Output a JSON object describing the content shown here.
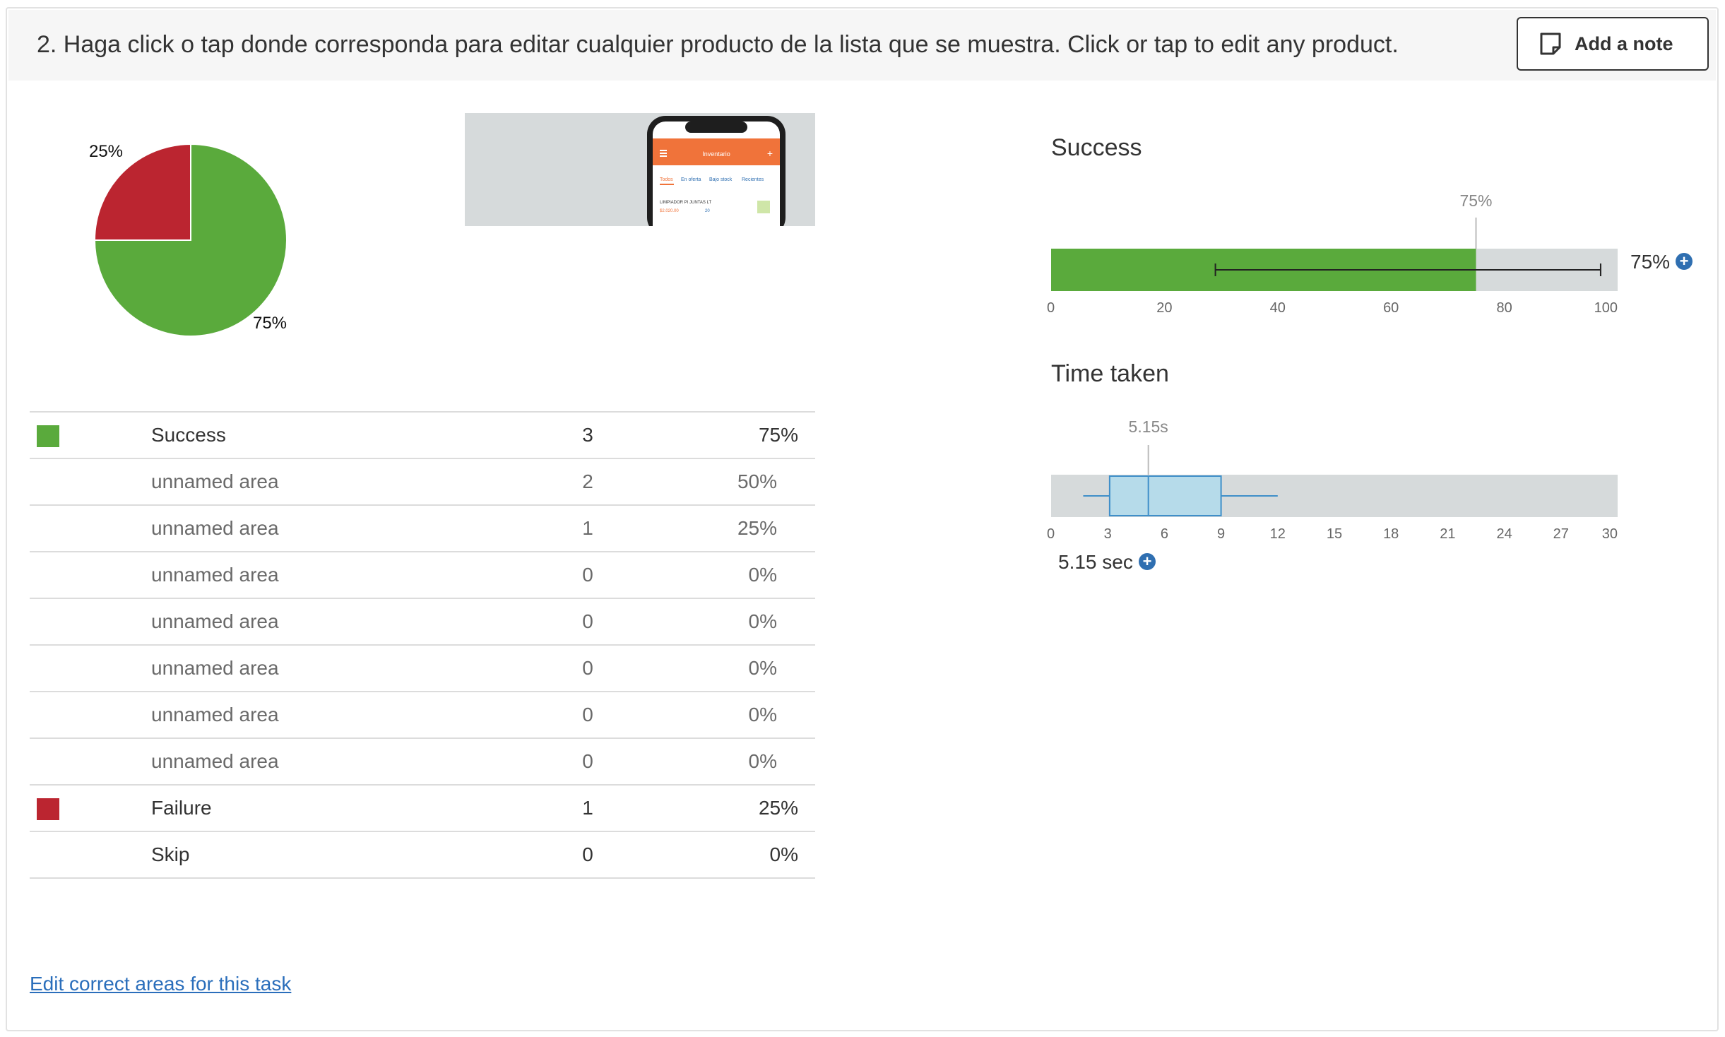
{
  "task": {
    "title": "2. Haga click o tap donde corresponda para editar cualquier producto de la lista que se muestra. Click or tap to edit any product.",
    "add_note_label": "Add a note"
  },
  "colors": {
    "success": "#5aaa3c",
    "failure": "#bb2530",
    "track": "#d6dadb",
    "box": "#b6dbea",
    "box_border": "#3f8fc9",
    "link": "#2a6ebb",
    "phone_header": "#f0733a"
  },
  "pie": {
    "labels": {
      "success": "75%",
      "failure": "25%"
    }
  },
  "thumbnail": {
    "header_text": "Inventario",
    "tabs": [
      "Todos",
      "En oferta",
      "Bajo stock",
      "Recientes"
    ],
    "item_text": "LIMPIADOR PI JUNTAS LT",
    "item_sub": "$2.020.00",
    "item_qty": "20"
  },
  "table": {
    "rows": [
      {
        "name": "Success",
        "count": "3",
        "pct": "75%",
        "type": "success"
      },
      {
        "name": "unnamed area",
        "count": "2",
        "pct": "50%",
        "type": "sub"
      },
      {
        "name": "unnamed area",
        "count": "1",
        "pct": "25%",
        "type": "sub"
      },
      {
        "name": "unnamed area",
        "count": "0",
        "pct": "0%",
        "type": "sub"
      },
      {
        "name": "unnamed area",
        "count": "0",
        "pct": "0%",
        "type": "sub"
      },
      {
        "name": "unnamed area",
        "count": "0",
        "pct": "0%",
        "type": "sub"
      },
      {
        "name": "unnamed area",
        "count": "0",
        "pct": "0%",
        "type": "sub"
      },
      {
        "name": "unnamed area",
        "count": "0",
        "pct": "0%",
        "type": "sub"
      },
      {
        "name": "Failure",
        "count": "1",
        "pct": "25%",
        "type": "failure"
      },
      {
        "name": "Skip",
        "count": "0",
        "pct": "0%",
        "type": "plain"
      }
    ]
  },
  "edit_link": "Edit correct areas for this task",
  "chart_data": [
    {
      "type": "pie",
      "series": [
        {
          "name": "Success",
          "value": 75
        },
        {
          "name": "Failure",
          "value": 25
        }
      ],
      "labels": [
        "75%",
        "25%"
      ]
    },
    {
      "type": "bar",
      "title": "Success",
      "value": 75,
      "value_label": "75%",
      "marker_label": "75%",
      "ci": [
        29,
        97
      ],
      "xlim": [
        0,
        100
      ],
      "ticks": [
        0,
        20,
        40,
        60,
        80,
        100
      ],
      "summary_label": "75%"
    },
    {
      "type": "boxplot",
      "title": "Time taken",
      "whisker_low": 4.3,
      "q1": 3.1,
      "median": 5.15,
      "q3": 9.0,
      "whisker_high": 12.0,
      "median_label": "5.15s",
      "xlim": [
        0,
        30
      ],
      "ticks": [
        0,
        3,
        6,
        9,
        12,
        15,
        18,
        21,
        24,
        27,
        30
      ],
      "summary_label": "5.15 sec"
    }
  ]
}
